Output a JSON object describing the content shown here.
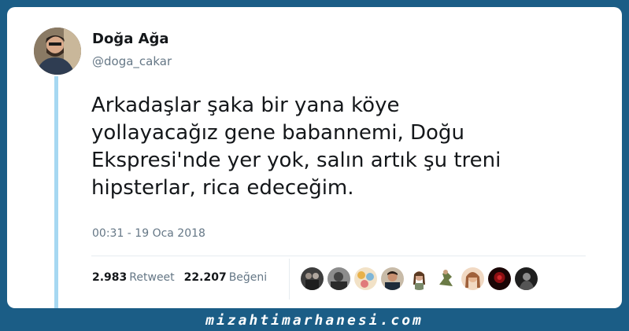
{
  "user": {
    "display_name": "Doğa Ağa",
    "handle": "@doga_cakar"
  },
  "tweet": {
    "text": "Arkadaşlar şaka bir yana köye\nyollayacağız gene babannemi,  Doğu\nEkspresi'nde yer yok, salın artık şu treni\nhipsterlar, rica edeceğim.",
    "timestamp": "00:31 - 19 Oca 2018"
  },
  "stats": {
    "retweet_count": "2.983",
    "retweet_label": "Retweet",
    "like_count": "22.207",
    "like_label": "Beğeni"
  },
  "likers_avatars": [
    "liker-avatar-1",
    "liker-avatar-2",
    "liker-avatar-3",
    "liker-avatar-4",
    "liker-avatar-5",
    "liker-avatar-6",
    "liker-avatar-7",
    "liker-avatar-8",
    "liker-avatar-9"
  ],
  "footer": {
    "watermark": "mizahtimarhanesi.com"
  },
  "colors": {
    "page_background": "#1b5d86",
    "thread_line": "#a6d8f2",
    "secondary_text": "#657786"
  }
}
